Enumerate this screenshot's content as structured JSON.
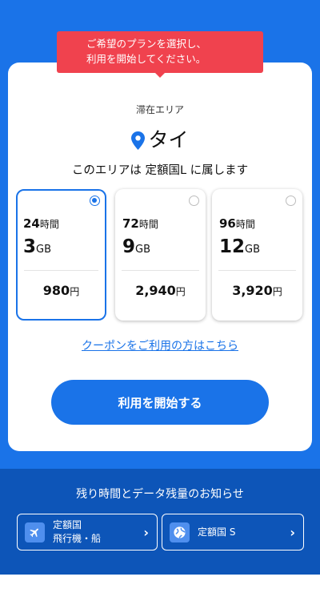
{
  "tooltip": {
    "line1": "ご希望のプランを選択し、",
    "line2": "利用を開始してください。"
  },
  "area": {
    "label": "滞在エリア",
    "country": "タイ",
    "belong_text": "このエリアは 定額国L に属します"
  },
  "plans": [
    {
      "hours": "24",
      "hours_unit": "時間",
      "data": "3",
      "data_unit": "GB",
      "price": "980",
      "price_unit": "円",
      "selected": true
    },
    {
      "hours": "72",
      "hours_unit": "時間",
      "data": "9",
      "data_unit": "GB",
      "price": "2,940",
      "price_unit": "円",
      "selected": false
    },
    {
      "hours": "96",
      "hours_unit": "時間",
      "data": "12",
      "data_unit": "GB",
      "price": "3,920",
      "price_unit": "円",
      "selected": false
    }
  ],
  "coupon_link": "クーポンをご利用の方はこちら",
  "start_button": "利用を開始する",
  "notice": {
    "title": "残り時間とデータ残量のお知らせ",
    "links": [
      {
        "icon": "airplane-icon",
        "line1": "定額国",
        "line2": "飛行機・船"
      },
      {
        "icon": "globe-icon",
        "line1": "定額国 S",
        "line2": ""
      }
    ]
  },
  "colors": {
    "brand_blue": "#1a73e8",
    "footer_blue": "#0d55b8",
    "tooltip_red": "#f0424e"
  }
}
